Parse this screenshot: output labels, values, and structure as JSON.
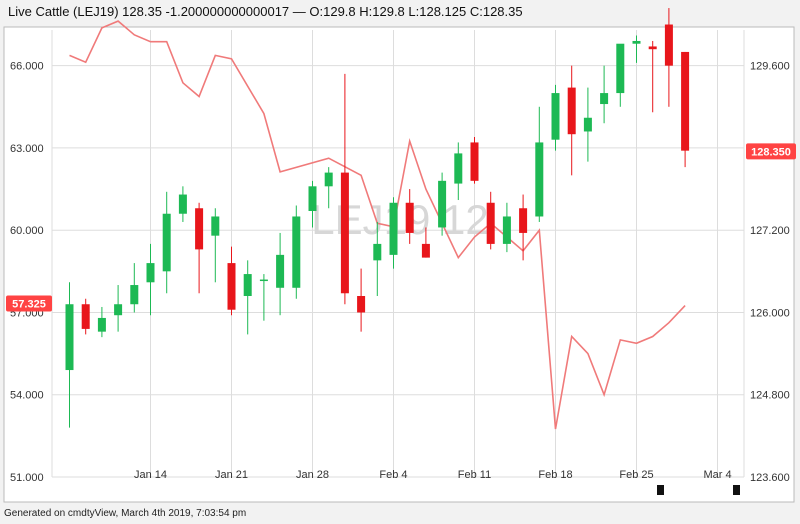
{
  "header": {
    "title": "Live Cattle (LEJ19) 128.35 -1.200000000000017 — O:129.8 H:129.8 L:128.125 C:128.35"
  },
  "footer": {
    "text": "Generated on cmdtyView, March 4th 2019, 7:03:54 pm"
  },
  "watermark": "LEJ19 12",
  "colors": {
    "up": "#1db954",
    "down": "#e8161b",
    "line": "#f07a7a",
    "grid": "#dddddd",
    "label_bg": "#ff4343"
  },
  "chart_data": {
    "type": "candlestick",
    "x_labels": [
      "Jan 14",
      "Jan 21",
      "Jan 28",
      "Feb 4",
      "Feb 11",
      "Feb 18",
      "Feb 25",
      "Mar 4"
    ],
    "x_label_index": [
      5,
      10,
      15,
      20,
      25,
      30,
      35,
      40
    ],
    "left_axis": {
      "ticks": [
        "66.000",
        "63.000",
        "60.000",
        "57.000",
        "54.000",
        "51.000"
      ],
      "tick_values": [
        66,
        63,
        60,
        57,
        54,
        51
      ],
      "range": [
        51,
        67.3
      ],
      "last_value_label": "57.325",
      "last_value": 57.325
    },
    "right_axis": {
      "ticks": [
        "129.600",
        "128.400",
        "127.200",
        "126.000",
        "124.800",
        "123.600"
      ],
      "tick_values": [
        129.6,
        128.4,
        127.2,
        126.0,
        124.8,
        123.6
      ],
      "range": [
        123.6,
        130.12
      ],
      "last_value_label": "128.350",
      "last_value": 128.35
    },
    "candles_axis": "left",
    "candles": [
      {
        "o": 54.9,
        "h": 58.1,
        "l": 52.8,
        "c": 57.3
      },
      {
        "o": 57.3,
        "h": 57.5,
        "l": 56.2,
        "c": 56.4
      },
      {
        "o": 56.3,
        "h": 57.2,
        "l": 56.1,
        "c": 56.8
      },
      {
        "o": 56.9,
        "h": 58.0,
        "l": 56.3,
        "c": 57.3
      },
      {
        "o": 57.3,
        "h": 58.8,
        "l": 57.0,
        "c": 58.0
      },
      {
        "o": 58.1,
        "h": 59.5,
        "l": 56.9,
        "c": 58.8
      },
      {
        "o": 58.5,
        "h": 61.4,
        "l": 57.7,
        "c": 60.6
      },
      {
        "o": 60.6,
        "h": 61.6,
        "l": 60.3,
        "c": 61.3
      },
      {
        "o": 60.8,
        "h": 61.0,
        "l": 57.7,
        "c": 59.3
      },
      {
        "o": 59.8,
        "h": 60.8,
        "l": 58.1,
        "c": 60.5
      },
      {
        "o": 58.8,
        "h": 59.4,
        "l": 56.9,
        "c": 57.1
      },
      {
        "o": 57.6,
        "h": 58.9,
        "l": 56.2,
        "c": 58.4
      },
      {
        "o": 58.2,
        "h": 58.4,
        "l": 56.7,
        "c": 58.2
      },
      {
        "o": 57.9,
        "h": 59.9,
        "l": 56.9,
        "c": 59.1
      },
      {
        "o": 57.9,
        "h": 60.9,
        "l": 57.5,
        "c": 60.5
      },
      {
        "o": 60.7,
        "h": 61.8,
        "l": 60.1,
        "c": 61.6
      },
      {
        "o": 61.6,
        "h": 62.3,
        "l": 60.8,
        "c": 62.1
      },
      {
        "o": 62.1,
        "h": 65.7,
        "l": 57.3,
        "c": 57.7
      },
      {
        "o": 57.6,
        "h": 58.6,
        "l": 56.3,
        "c": 57.0
      },
      {
        "o": 58.9,
        "h": 60.3,
        "l": 57.6,
        "c": 59.5
      },
      {
        "o": 59.1,
        "h": 61.2,
        "l": 58.6,
        "c": 61.0
      },
      {
        "o": 61.0,
        "h": 61.5,
        "l": 59.5,
        "c": 59.9
      },
      {
        "o": 59.5,
        "h": 60.1,
        "l": 59.0,
        "c": 59.0
      },
      {
        "o": 60.1,
        "h": 62.1,
        "l": 59.8,
        "c": 61.8
      },
      {
        "o": 61.7,
        "h": 63.2,
        "l": 61.1,
        "c": 62.8
      },
      {
        "o": 63.2,
        "h": 63.4,
        "l": 61.7,
        "c": 61.8
      },
      {
        "o": 61.0,
        "h": 61.4,
        "l": 59.3,
        "c": 59.5
      },
      {
        "o": 59.5,
        "h": 61.0,
        "l": 59.2,
        "c": 60.5
      },
      {
        "o": 60.8,
        "h": 61.3,
        "l": 58.9,
        "c": 59.9
      },
      {
        "o": 60.5,
        "h": 64.5,
        "l": 60.3,
        "c": 63.2
      },
      {
        "o": 63.3,
        "h": 65.3,
        "l": 62.9,
        "c": 65.0
      },
      {
        "o": 65.2,
        "h": 66.0,
        "l": 62.0,
        "c": 63.5
      },
      {
        "o": 63.6,
        "h": 65.2,
        "l": 62.5,
        "c": 64.1
      },
      {
        "o": 64.6,
        "h": 66.0,
        "l": 63.9,
        "c": 65.0
      },
      {
        "o": 65.0,
        "h": 66.6,
        "l": 64.5,
        "c": 66.8
      },
      {
        "o": 66.8,
        "h": 67.1,
        "l": 66.1,
        "c": 66.9
      },
      {
        "o": 66.7,
        "h": 66.9,
        "l": 64.3,
        "c": 66.6
      },
      {
        "o": 67.5,
        "h": 68.1,
        "l": 64.5,
        "c": 66.0
      },
      {
        "o": 66.5,
        "h": 66.5,
        "l": 62.3,
        "c": 62.9
      }
    ],
    "line_axis": "right",
    "line": [
      {
        "i": 0,
        "v": 129.75
      },
      {
        "i": 1,
        "v": 129.65
      },
      {
        "i": 2,
        "v": 130.15
      },
      {
        "i": 3,
        "v": 130.25
      },
      {
        "i": 4,
        "v": 130.05
      },
      {
        "i": 5,
        "v": 129.95
      },
      {
        "i": 6,
        "v": 129.95
      },
      {
        "i": 7,
        "v": 129.35
      },
      {
        "i": 8,
        "v": 129.15
      },
      {
        "i": 9,
        "v": 129.75
      },
      {
        "i": 10,
        "v": 129.7
      },
      {
        "i": 12,
        "v": 128.9
      },
      {
        "i": 13,
        "v": 128.05
      },
      {
        "i": 16,
        "v": 128.25
      },
      {
        "i": 18,
        "v": 128.0
      },
      {
        "i": 19,
        "v": 127.3
      },
      {
        "i": 20,
        "v": 127.25
      },
      {
        "i": 21,
        "v": 128.5
      },
      {
        "i": 22,
        "v": 127.8
      },
      {
        "i": 24,
        "v": 126.8
      },
      {
        "i": 25,
        "v": 127.1
      },
      {
        "i": 26,
        "v": 127.3
      },
      {
        "i": 28,
        "v": 126.9
      },
      {
        "i": 29,
        "v": 127.2
      },
      {
        "i": 30,
        "v": 124.3
      },
      {
        "i": 31,
        "v": 125.65
      },
      {
        "i": 32,
        "v": 125.4
      },
      {
        "i": 33,
        "v": 124.8
      },
      {
        "i": 34,
        "v": 125.6
      },
      {
        "i": 35,
        "v": 125.55
      },
      {
        "i": 36,
        "v": 125.65
      },
      {
        "i": 37,
        "v": 125.85
      },
      {
        "i": 38,
        "v": 126.1
      }
    ]
  }
}
